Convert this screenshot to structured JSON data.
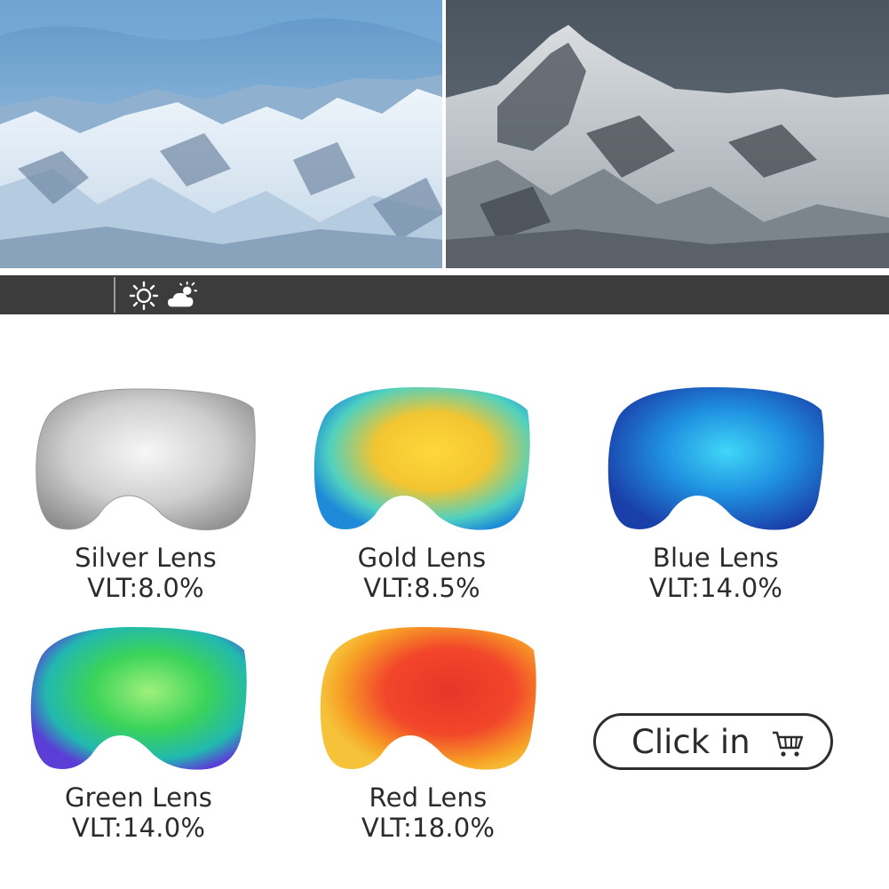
{
  "hero": {
    "left_view": "bright mountains",
    "right_view": "tinted mountains"
  },
  "condition_bar": {
    "icons": [
      "sun-icon",
      "partly-cloudy-icon"
    ]
  },
  "lenses": [
    {
      "name": "Silver Lens",
      "vlt": "VLT:8.0%",
      "color": "#c9c9c9"
    },
    {
      "name": "Gold Lens",
      "vlt": "VLT:8.5%",
      "color": "#f2c531"
    },
    {
      "name": "Blue Lens",
      "vlt": "VLT:14.0%",
      "color": "#1f8fe0"
    },
    {
      "name": "Green Lens",
      "vlt": "VLT:14.0%",
      "color": "#3ad35a"
    },
    {
      "name": "Red Lens",
      "vlt": "VLT:18.0%",
      "color": "#f2462a"
    }
  ],
  "cta": {
    "label": "Click in",
    "icon": "cart-icon"
  }
}
